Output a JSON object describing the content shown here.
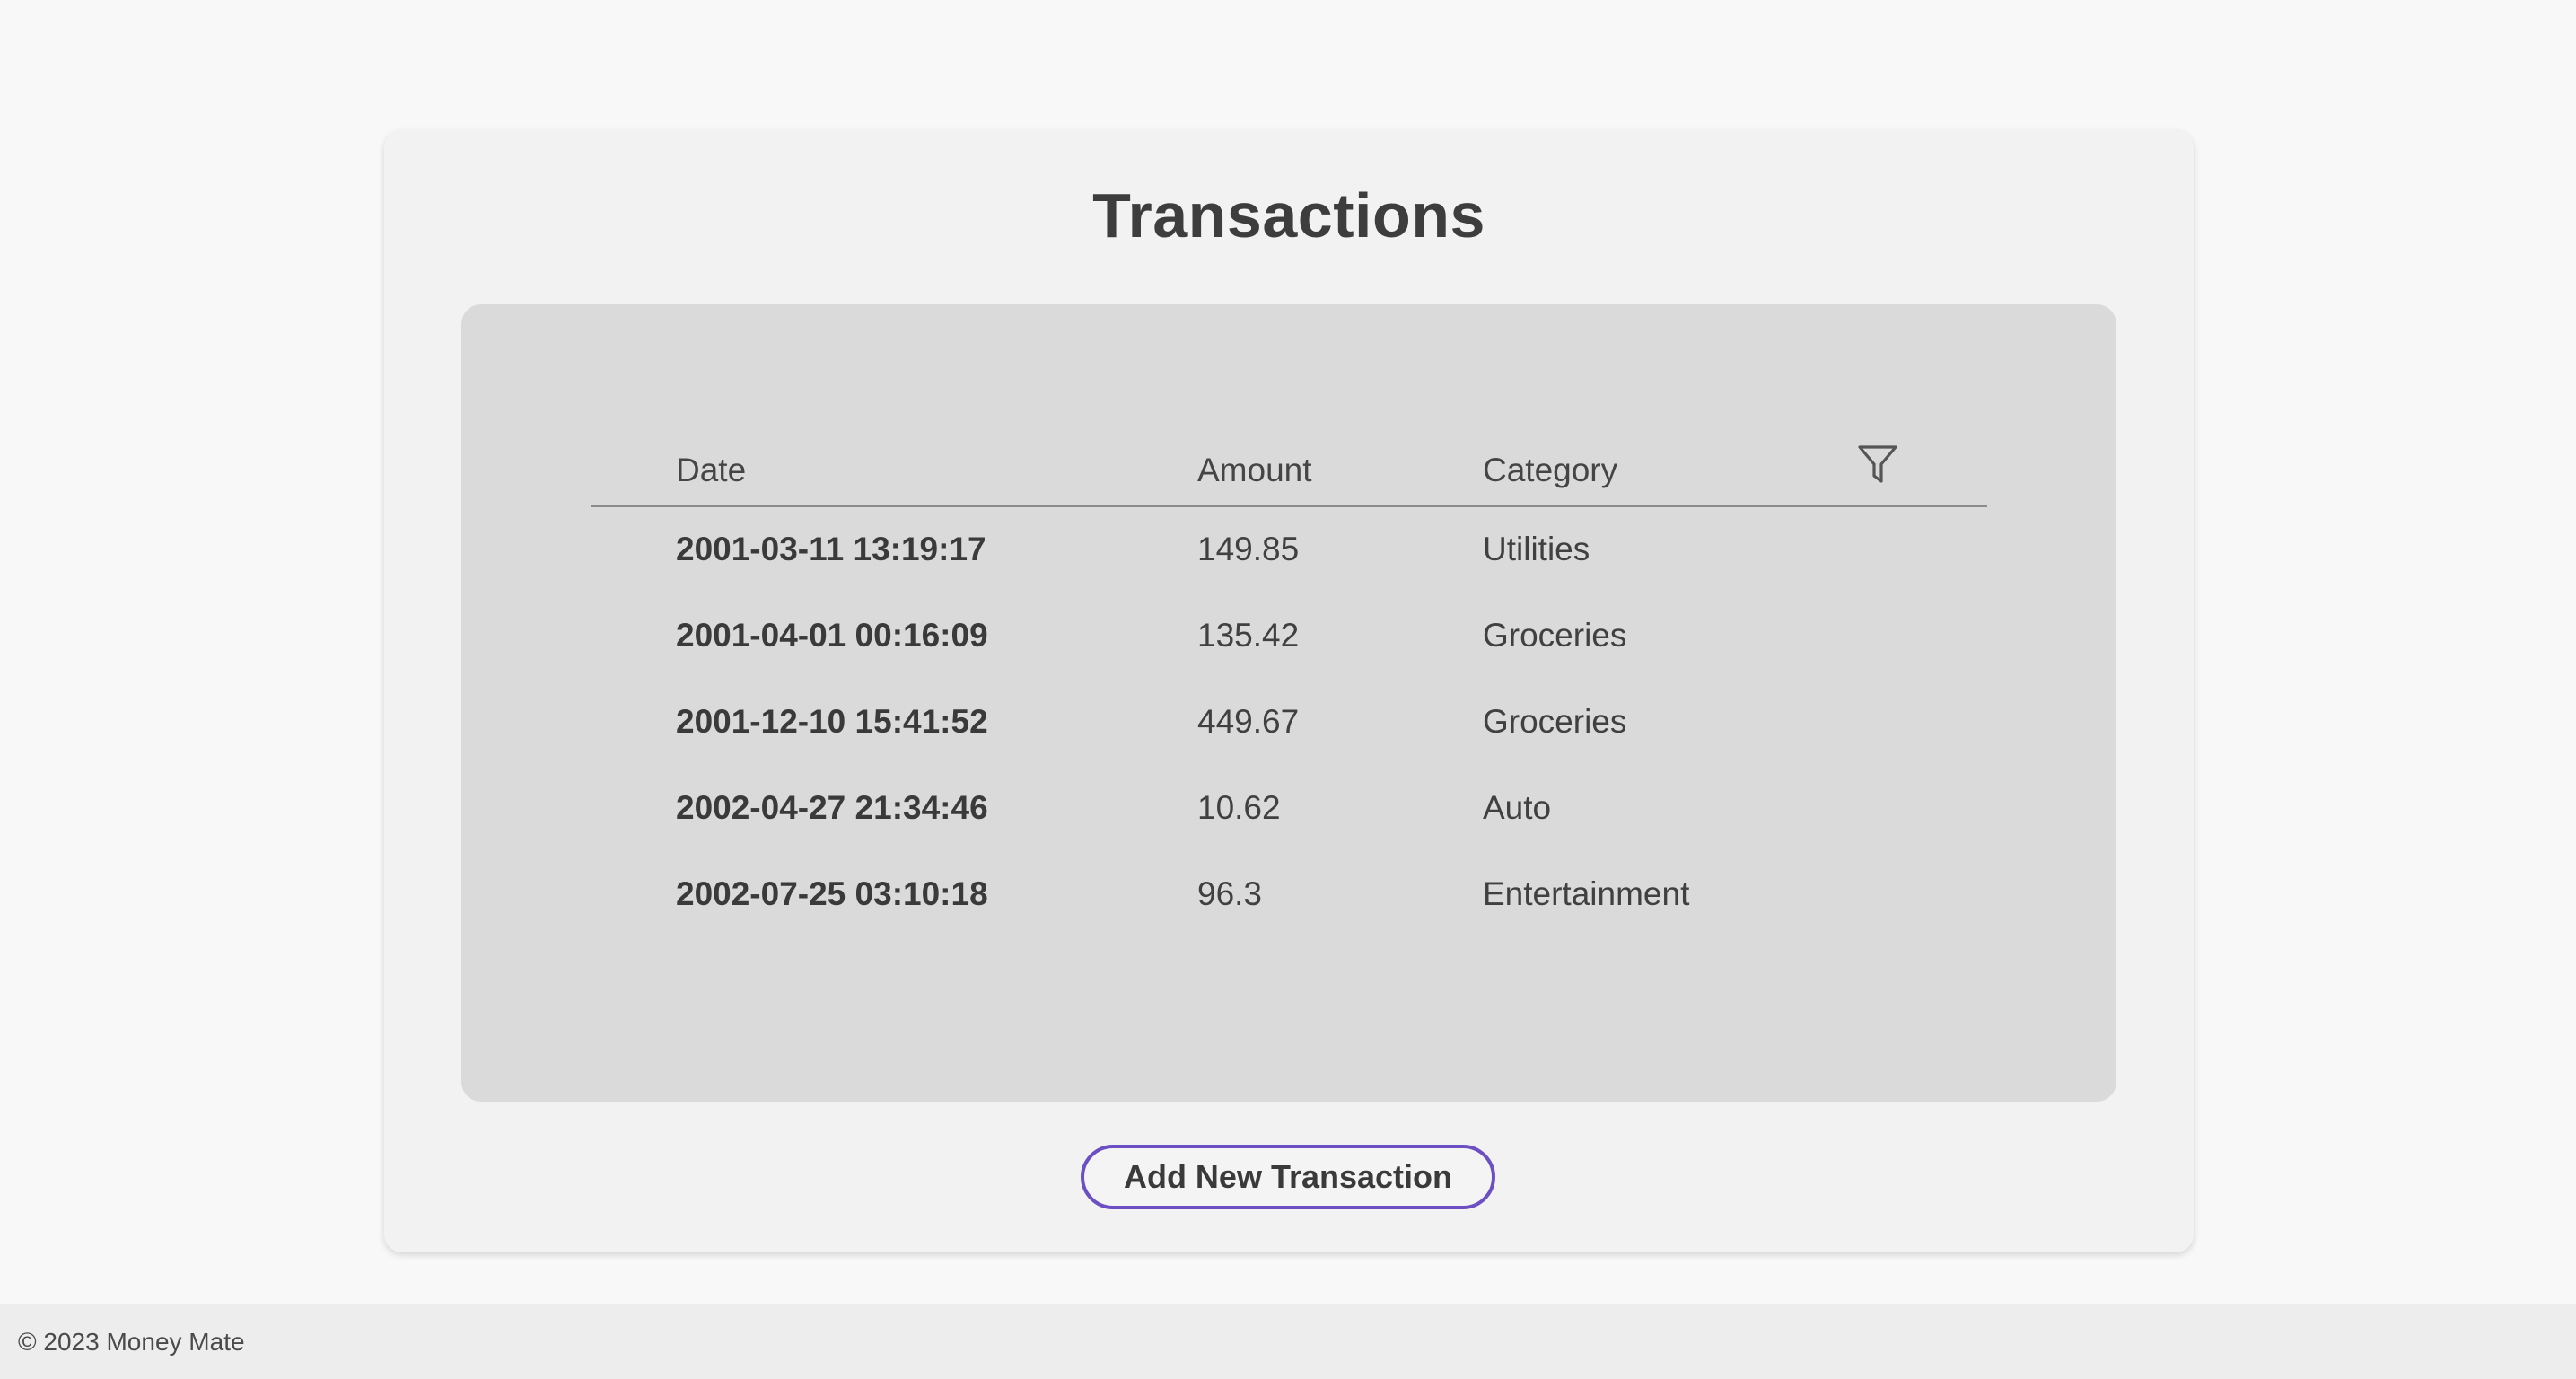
{
  "page": {
    "title": "Transactions"
  },
  "table": {
    "headers": {
      "date": "Date",
      "amount": "Amount",
      "category": "Category"
    },
    "filter_icon": "filter-funnel-icon",
    "rows": [
      {
        "date": "2001-03-11 13:19:17",
        "amount": "149.85",
        "category": "Utilities"
      },
      {
        "date": "2001-04-01 00:16:09",
        "amount": "135.42",
        "category": "Groceries"
      },
      {
        "date": "2001-12-10 15:41:52",
        "amount": "449.67",
        "category": "Groceries"
      },
      {
        "date": "2002-04-27 21:34:46",
        "amount": "10.62",
        "category": "Auto"
      },
      {
        "date": "2002-07-25 03:10:18",
        "amount": "96.3",
        "category": "Entertainment"
      }
    ]
  },
  "actions": {
    "add_label": "Add New Transaction"
  },
  "footer": {
    "text": "© 2023 Money Mate"
  },
  "colors": {
    "accent": "#6d4fc4",
    "background": "#f8f8f8",
    "card": "#f2f2f2",
    "table_panel": "#dadada"
  }
}
